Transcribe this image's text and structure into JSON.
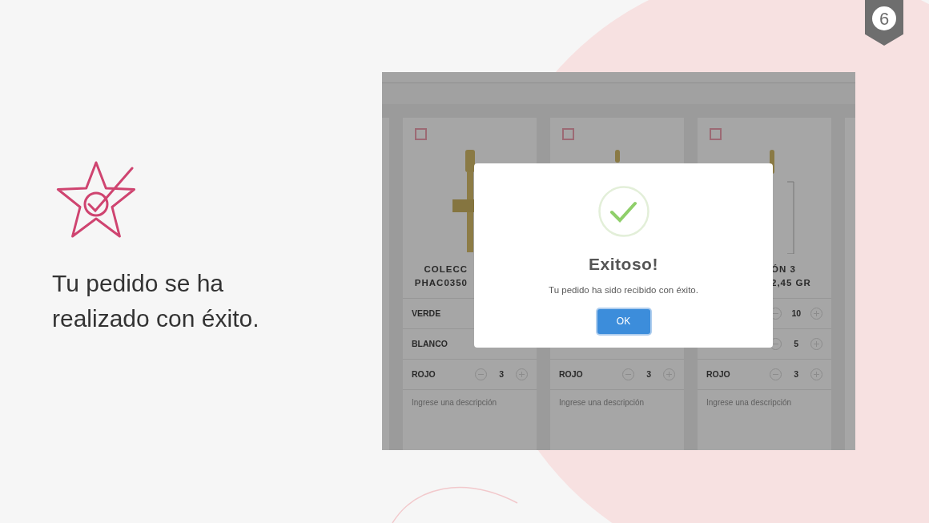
{
  "slide": {
    "badge": "6",
    "message": "Tu pedido se ha realizado con éxito."
  },
  "app": {
    "cards": [
      {
        "checked": false,
        "title": [
          "COLECC",
          "PHAC0350"
        ],
        "rows": [
          {
            "label": "VERDE"
          },
          {
            "label": "BLANCO"
          },
          {
            "label": "ROJO",
            "qty": "3"
          }
        ],
        "placeholder": "Ingrese una descripción"
      },
      {
        "checked": false,
        "rows": [
          {
            "label": "ROJO",
            "qty": "3"
          }
        ],
        "placeholder": "Ingrese una descripción"
      },
      {
        "checked": false,
        "title": [
          "ÓN 3",
          "2,45 GR"
        ],
        "rows": [
          {
            "qty": "10"
          },
          {
            "qty": "5"
          },
          {
            "label": "ROJO",
            "qty": "3"
          }
        ],
        "placeholder": "Ingrese una descripción"
      }
    ],
    "dialog": {
      "title": "Exitoso!",
      "message": "Tu pedido ha sido recibido con éxito.",
      "button": "OK"
    }
  }
}
